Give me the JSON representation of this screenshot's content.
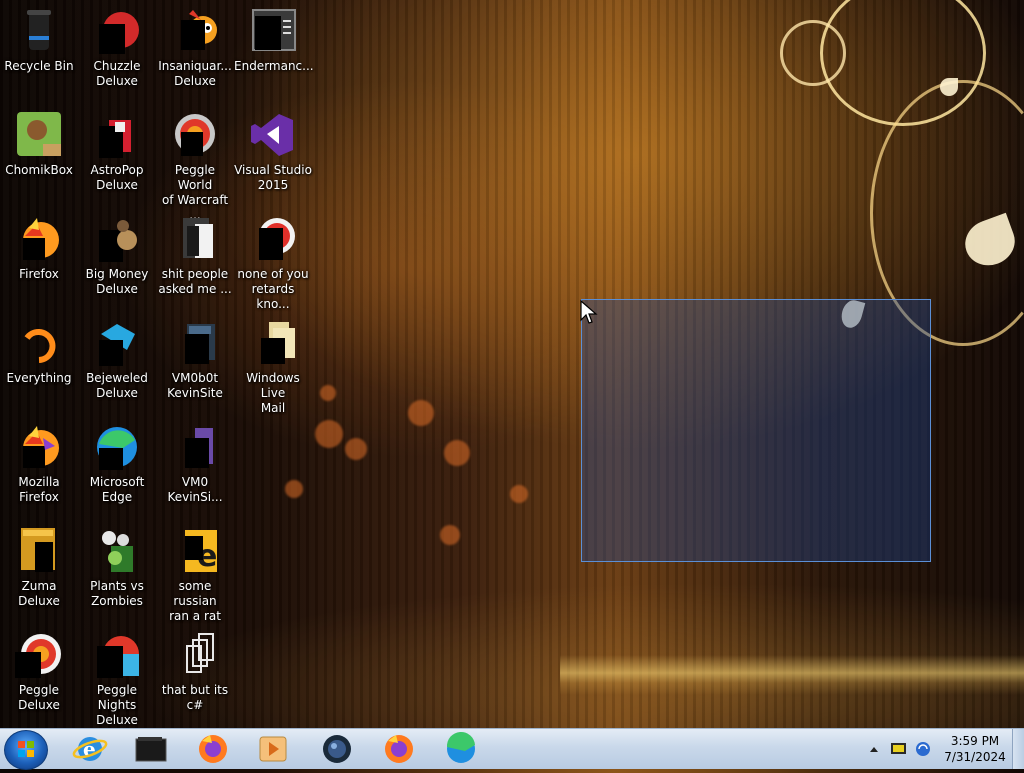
{
  "desktop": {
    "icons": [
      {
        "label": "Recycle Bin",
        "name": "recycle-bin"
      },
      {
        "label": "ChomikBox",
        "name": "chomikbox"
      },
      {
        "label": "Firefox",
        "name": "firefox"
      },
      {
        "label": "Everything",
        "name": "everything"
      },
      {
        "label": "Mozilla\nFirefox",
        "name": "mozilla-firefox"
      },
      {
        "label": "Zuma Deluxe",
        "name": "zuma-deluxe"
      },
      {
        "label": "Peggle Deluxe",
        "name": "peggle-deluxe"
      },
      {
        "label": "Chuzzle\nDeluxe",
        "name": "chuzzle-deluxe"
      },
      {
        "label": "AstroPop\nDeluxe",
        "name": "astropop-deluxe"
      },
      {
        "label": "Big Money\nDeluxe",
        "name": "big-money-deluxe"
      },
      {
        "label": "Bejeweled\nDeluxe",
        "name": "bejeweled-deluxe"
      },
      {
        "label": "Microsoft\nEdge",
        "name": "microsoft-edge"
      },
      {
        "label": "Plants vs\nZombies",
        "name": "plants-vs-zombies"
      },
      {
        "label": "Peggle Nights\nDeluxe",
        "name": "peggle-nights-deluxe"
      },
      {
        "label": "Insaniquar...\nDeluxe",
        "name": "insaniquarium-deluxe"
      },
      {
        "label": "Peggle World\nof Warcraft ...",
        "name": "peggle-world-of-warcraft"
      },
      {
        "label": "shit people\nasked me ...",
        "name": "shit-people-asked-me"
      },
      {
        "label": "VM0b0t\nKevinSite",
        "name": "vm0b0t-kevinsite"
      },
      {
        "label": "VM0\nKevinSi...",
        "name": "vm0-kevinsite"
      },
      {
        "label": "some russian\nran a rat",
        "name": "some-russian-ran-a-rat"
      },
      {
        "label": "that but its c#",
        "name": "that-but-its-csharp"
      },
      {
        "label": "Endermanc...",
        "name": "endermanch"
      },
      {
        "label": "Visual Studio\n2015",
        "name": "visual-studio-2015"
      },
      {
        "label": "none of you\nretards kno...",
        "name": "none-of-you"
      },
      {
        "label": "Windows Live\nMail",
        "name": "windows-live-mail"
      }
    ]
  },
  "taskbar": {
    "pinned": [
      {
        "name": "internet-explorer"
      },
      {
        "name": "black-folder"
      },
      {
        "name": "firefox"
      },
      {
        "name": "media-player"
      },
      {
        "name": "dark-globe"
      },
      {
        "name": "firefox-2"
      },
      {
        "name": "edge"
      }
    ],
    "clock": {
      "time": "3:59 PM",
      "date": "7/31/2024"
    }
  },
  "colors": {
    "taskbar": "#c9d8ea",
    "selection_border": "#5b8fd6",
    "selection_fill": "#1e4696"
  }
}
